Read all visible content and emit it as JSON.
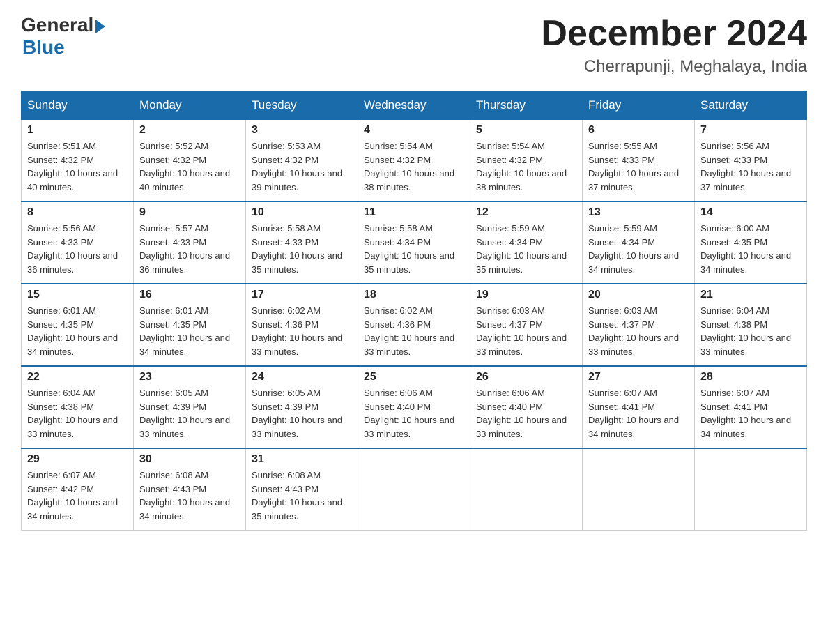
{
  "logo": {
    "general": "General",
    "blue": "Blue"
  },
  "title": "December 2024",
  "location": "Cherrapunji, Meghalaya, India",
  "days_of_week": [
    "Sunday",
    "Monday",
    "Tuesday",
    "Wednesday",
    "Thursday",
    "Friday",
    "Saturday"
  ],
  "weeks": [
    [
      {
        "day": "1",
        "sunrise": "5:51 AM",
        "sunset": "4:32 PM",
        "daylight": "10 hours and 40 minutes."
      },
      {
        "day": "2",
        "sunrise": "5:52 AM",
        "sunset": "4:32 PM",
        "daylight": "10 hours and 40 minutes."
      },
      {
        "day": "3",
        "sunrise": "5:53 AM",
        "sunset": "4:32 PM",
        "daylight": "10 hours and 39 minutes."
      },
      {
        "day": "4",
        "sunrise": "5:54 AM",
        "sunset": "4:32 PM",
        "daylight": "10 hours and 38 minutes."
      },
      {
        "day": "5",
        "sunrise": "5:54 AM",
        "sunset": "4:32 PM",
        "daylight": "10 hours and 38 minutes."
      },
      {
        "day": "6",
        "sunrise": "5:55 AM",
        "sunset": "4:33 PM",
        "daylight": "10 hours and 37 minutes."
      },
      {
        "day": "7",
        "sunrise": "5:56 AM",
        "sunset": "4:33 PM",
        "daylight": "10 hours and 37 minutes."
      }
    ],
    [
      {
        "day": "8",
        "sunrise": "5:56 AM",
        "sunset": "4:33 PM",
        "daylight": "10 hours and 36 minutes."
      },
      {
        "day": "9",
        "sunrise": "5:57 AM",
        "sunset": "4:33 PM",
        "daylight": "10 hours and 36 minutes."
      },
      {
        "day": "10",
        "sunrise": "5:58 AM",
        "sunset": "4:33 PM",
        "daylight": "10 hours and 35 minutes."
      },
      {
        "day": "11",
        "sunrise": "5:58 AM",
        "sunset": "4:34 PM",
        "daylight": "10 hours and 35 minutes."
      },
      {
        "day": "12",
        "sunrise": "5:59 AM",
        "sunset": "4:34 PM",
        "daylight": "10 hours and 35 minutes."
      },
      {
        "day": "13",
        "sunrise": "5:59 AM",
        "sunset": "4:34 PM",
        "daylight": "10 hours and 34 minutes."
      },
      {
        "day": "14",
        "sunrise": "6:00 AM",
        "sunset": "4:35 PM",
        "daylight": "10 hours and 34 minutes."
      }
    ],
    [
      {
        "day": "15",
        "sunrise": "6:01 AM",
        "sunset": "4:35 PM",
        "daylight": "10 hours and 34 minutes."
      },
      {
        "day": "16",
        "sunrise": "6:01 AM",
        "sunset": "4:35 PM",
        "daylight": "10 hours and 34 minutes."
      },
      {
        "day": "17",
        "sunrise": "6:02 AM",
        "sunset": "4:36 PM",
        "daylight": "10 hours and 33 minutes."
      },
      {
        "day": "18",
        "sunrise": "6:02 AM",
        "sunset": "4:36 PM",
        "daylight": "10 hours and 33 minutes."
      },
      {
        "day": "19",
        "sunrise": "6:03 AM",
        "sunset": "4:37 PM",
        "daylight": "10 hours and 33 minutes."
      },
      {
        "day": "20",
        "sunrise": "6:03 AM",
        "sunset": "4:37 PM",
        "daylight": "10 hours and 33 minutes."
      },
      {
        "day": "21",
        "sunrise": "6:04 AM",
        "sunset": "4:38 PM",
        "daylight": "10 hours and 33 minutes."
      }
    ],
    [
      {
        "day": "22",
        "sunrise": "6:04 AM",
        "sunset": "4:38 PM",
        "daylight": "10 hours and 33 minutes."
      },
      {
        "day": "23",
        "sunrise": "6:05 AM",
        "sunset": "4:39 PM",
        "daylight": "10 hours and 33 minutes."
      },
      {
        "day": "24",
        "sunrise": "6:05 AM",
        "sunset": "4:39 PM",
        "daylight": "10 hours and 33 minutes."
      },
      {
        "day": "25",
        "sunrise": "6:06 AM",
        "sunset": "4:40 PM",
        "daylight": "10 hours and 33 minutes."
      },
      {
        "day": "26",
        "sunrise": "6:06 AM",
        "sunset": "4:40 PM",
        "daylight": "10 hours and 33 minutes."
      },
      {
        "day": "27",
        "sunrise": "6:07 AM",
        "sunset": "4:41 PM",
        "daylight": "10 hours and 34 minutes."
      },
      {
        "day": "28",
        "sunrise": "6:07 AM",
        "sunset": "4:41 PM",
        "daylight": "10 hours and 34 minutes."
      }
    ],
    [
      {
        "day": "29",
        "sunrise": "6:07 AM",
        "sunset": "4:42 PM",
        "daylight": "10 hours and 34 minutes."
      },
      {
        "day": "30",
        "sunrise": "6:08 AM",
        "sunset": "4:43 PM",
        "daylight": "10 hours and 34 minutes."
      },
      {
        "day": "31",
        "sunrise": "6:08 AM",
        "sunset": "4:43 PM",
        "daylight": "10 hours and 35 minutes."
      },
      null,
      null,
      null,
      null
    ]
  ]
}
